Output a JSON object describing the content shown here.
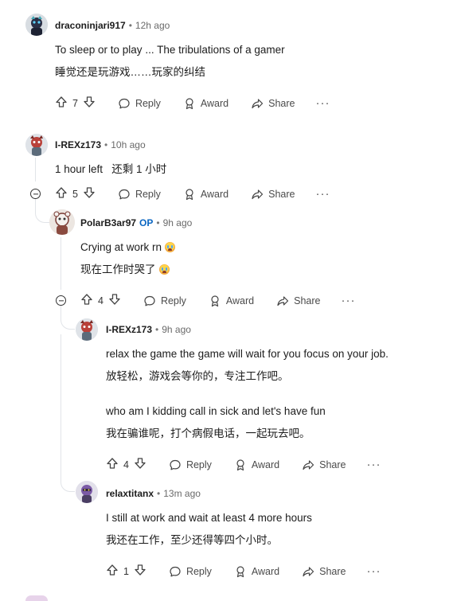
{
  "comments": [
    {
      "username": "draconinjari917",
      "time": "12h ago",
      "lines": [
        "To sleep or to play ... The tribulations of a gamer",
        "睡觉还是玩游戏……玩家的纠结"
      ],
      "votes": "7"
    },
    {
      "username": "I-REXz173",
      "time": "10h ago",
      "lines": [
        "1 hour left   还剩 1 小时"
      ],
      "votes": "5"
    },
    {
      "username": "PolarB3ar97",
      "op_badge": "OP",
      "time": "9h ago",
      "lines": [
        "Crying at work rn",
        "现在工作时哭了"
      ],
      "votes": "4"
    },
    {
      "username": "I-REXz173",
      "time": "9h ago",
      "lines": [
        "relax the game the game will wait for you focus on your job.",
        "放轻松，游戏会等你的，专注工作吧。",
        "who am I kidding call in sick and let's have fun",
        "我在骗谁呢，打个病假电话，一起玩去吧。"
      ],
      "votes": "4"
    },
    {
      "username": "relaxtitanx",
      "time": "13m ago",
      "lines": [
        "I still at work and wait at least 4 more hours",
        "我还在工作，至少还得等四个小时。"
      ],
      "votes": "1"
    }
  ],
  "ui": {
    "separator": "•",
    "reply_label": "Reply",
    "award_label": "Award",
    "share_label": "Share",
    "more_label": "···"
  },
  "icons": [
    "upvote-icon",
    "downvote-icon",
    "reply-icon",
    "award-icon",
    "share-icon",
    "more-icon",
    "collapse-icon",
    "crying-emoji"
  ]
}
